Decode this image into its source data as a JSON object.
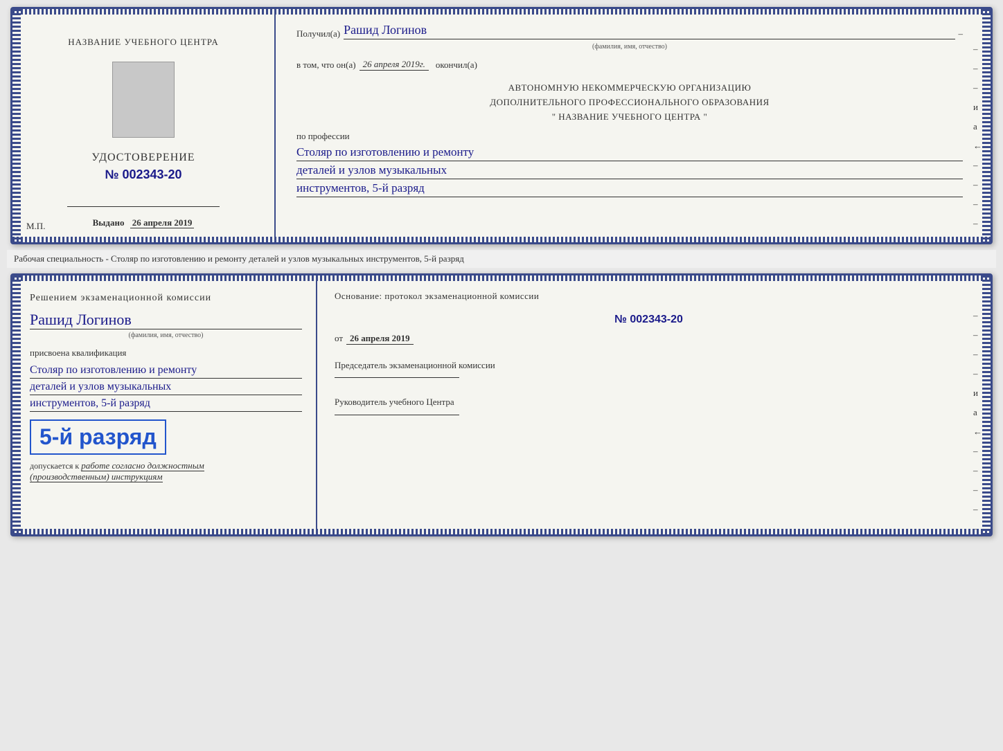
{
  "top_card": {
    "left": {
      "center_title": "НАЗВАНИЕ УЧЕБНОГО ЦЕНТРА",
      "cert_label": "УДОСТОВЕРЕНИЕ",
      "cert_number": "№ 002343-20",
      "issued_prefix": "Выдано",
      "issued_date": "26 апреля 2019",
      "mp_label": "М.П."
    },
    "right": {
      "recipient_label": "Получил(а)",
      "recipient_name": "Рашид Логинов",
      "recipient_subtitle": "(фамилия, имя, отчество)",
      "date_prefix": "в том, что он(а)",
      "date_value": "26 апреля 2019г.",
      "date_suffix": "окончил(а)",
      "org_line1": "АВТОНОМНУЮ НЕКОММЕРЧЕСКУЮ ОРГАНИЗАЦИЮ",
      "org_line2": "ДОПОЛНИТЕЛЬНОГО ПРОФЕССИОНАЛЬНОГО ОБРАЗОВАНИЯ",
      "org_line3": "\"   НАЗВАНИЕ УЧЕБНОГО ЦЕНТРА   \"",
      "profession_label": "по профессии",
      "profession_line1": "Столяр по изготовлению и ремонту",
      "profession_line2": "деталей и узлов музыкальных",
      "profession_line3": "инструментов, 5-й разряд",
      "side_chars": [
        "–",
        "–",
        "–",
        "и",
        "а",
        "←",
        "–",
        "–",
        "–",
        "–",
        "–"
      ]
    }
  },
  "between_label": "Рабочая специальность - Столяр по изготовлению и ремонту деталей и узлов музыкальных инструментов, 5-й разряд",
  "bottom_card": {
    "left": {
      "commission_title": "Решением экзаменационной комиссии",
      "person_name": "Рашид Логинов",
      "name_subtitle": "(фамилия, имя, отчество)",
      "qualification_label": "присвоена квалификация",
      "qual_line1": "Столяр по изготовлению и ремонту",
      "qual_line2": "деталей и узлов музыкальных",
      "qual_line3": "инструментов, 5-й разряд",
      "rank_text": "5-й разряд",
      "допускается_prefix": "допускается к",
      "допускается_value": "работе согласно должностным",
      "допускается_line2": "(производственным) инструкциям"
    },
    "right": {
      "basis_label": "Основание: протокол экзаменационной комиссии",
      "protocol_number": "№  002343-20",
      "from_prefix": "от",
      "from_value": "26 апреля 2019",
      "chairman_label": "Председатель экзаменационной комиссии",
      "director_label": "Руководитель учебного Центра",
      "side_chars": [
        "–",
        "–",
        "–",
        "–",
        "и",
        "а",
        "←",
        "–",
        "–",
        "–",
        "–",
        "–"
      ]
    }
  }
}
